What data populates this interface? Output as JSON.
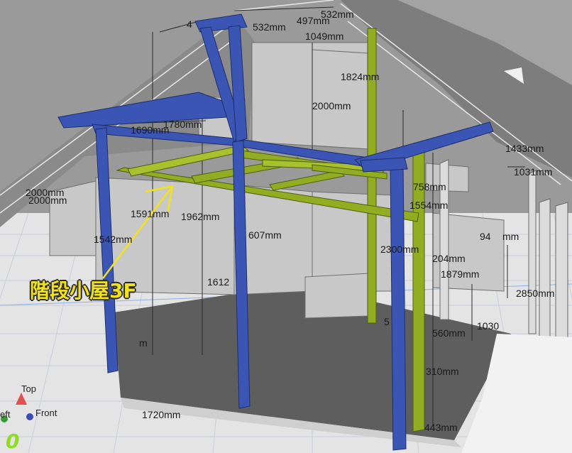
{
  "annotation": {
    "label": "階段小屋3F",
    "color": "#f2e21c"
  },
  "colors": {
    "blue_frame": "#3a55b4",
    "green_frame": "#93ad22",
    "roof": "#8c8c8c",
    "floor_grid": "#e2e2e2"
  },
  "view_cube": {
    "top": "Top",
    "front": "Front",
    "left": "eft"
  },
  "dimensions": [
    "532mm",
    "497mm",
    "1049mm",
    "4",
    "532mm",
    "1824mm",
    "2000mm",
    "1690mm",
    "1780mm",
    "1433mm",
    "1031mm",
    "758mm",
    "1554mm",
    "1591mm",
    "1962mm",
    "607mm",
    "1542mm",
    "94",
    "mm",
    "2300mm",
    "204mm",
    "1879mm",
    "1612",
    "2850mm",
    "560mm",
    "1030",
    "310mm",
    "443mm",
    "1720mm",
    "2000mm",
    "2000mm",
    "5",
    "m"
  ],
  "icons": [
    "view-cube-icon",
    "annotation-arrow-icon"
  ]
}
